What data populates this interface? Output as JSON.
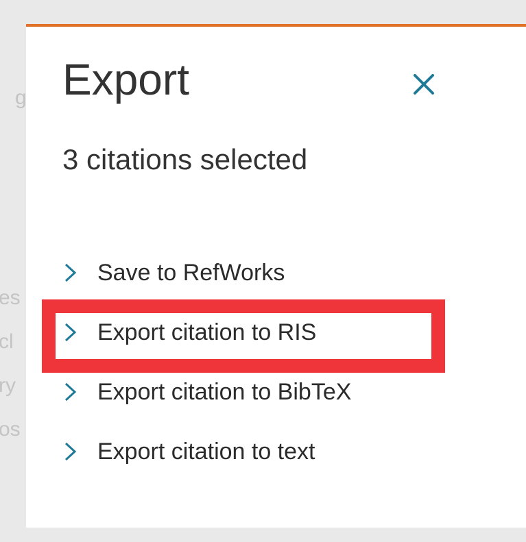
{
  "dialog": {
    "title": "Export",
    "close_label": "Close",
    "selection_count_text": "3 citations selected",
    "options": [
      {
        "label": "Save to RefWorks"
      },
      {
        "label": "Export citation to RIS"
      },
      {
        "label": "Export citation to BibTeX"
      },
      {
        "label": "Export citation to text"
      }
    ],
    "highlighted_option_index": 1
  },
  "background_fragments": [
    "g",
    "es",
    "cl",
    "ry",
    "os"
  ],
  "colors": {
    "accent_bar": "#e07028",
    "link_icon": "#1f7a98",
    "highlight": "#f0353a",
    "text": "#333333"
  },
  "icons": {
    "close": "close-icon",
    "option": "chevron-right-icon"
  }
}
